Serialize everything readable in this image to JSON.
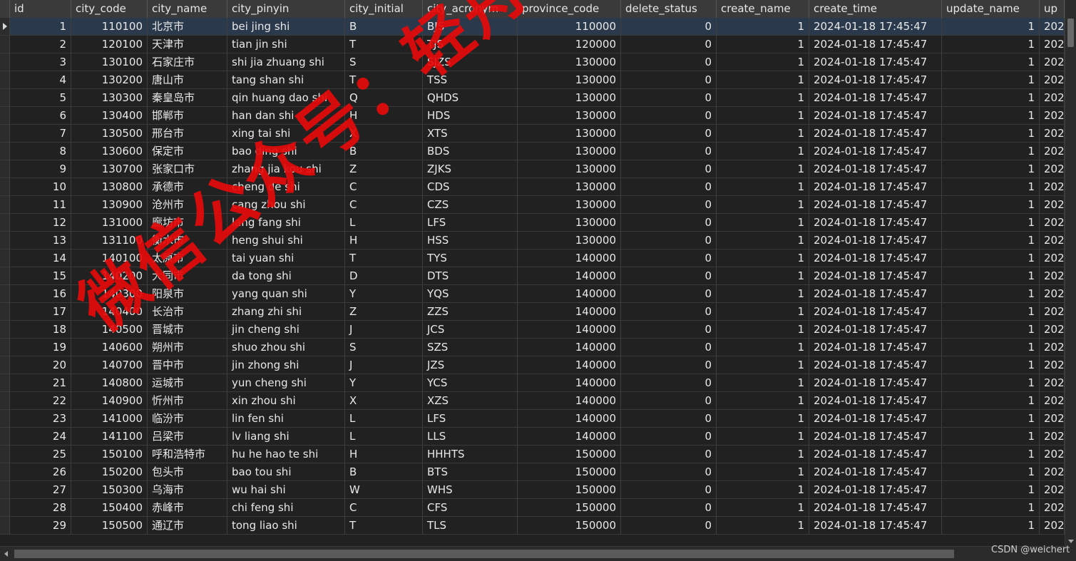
{
  "columns": [
    "id",
    "city_code",
    "city_name",
    "city_pinyin",
    "city_initial",
    "city_acronym",
    "province_code",
    "delete_status",
    "create_name",
    "create_time",
    "update_name",
    "up"
  ],
  "rows": [
    [
      "1",
      "110100",
      "北京市",
      "bei jing shi",
      "B",
      "BJS",
      "110000",
      "0",
      "1",
      "2024-01-18 17:45:47",
      "1",
      "202"
    ],
    [
      "2",
      "120100",
      "天津市",
      "tian jin shi",
      "T",
      "TJS",
      "120000",
      "0",
      "1",
      "2024-01-18 17:45:47",
      "1",
      "202"
    ],
    [
      "3",
      "130100",
      "石家庄市",
      "shi jia zhuang shi",
      "S",
      "SJZS",
      "130000",
      "0",
      "1",
      "2024-01-18 17:45:47",
      "1",
      "202"
    ],
    [
      "4",
      "130200",
      "唐山市",
      "tang shan shi",
      "T",
      "TSS",
      "130000",
      "0",
      "1",
      "2024-01-18 17:45:47",
      "1",
      "202"
    ],
    [
      "5",
      "130300",
      "秦皇岛市",
      "qin huang dao shi",
      "Q",
      "QHDS",
      "130000",
      "0",
      "1",
      "2024-01-18 17:45:47",
      "1",
      "202"
    ],
    [
      "6",
      "130400",
      "邯郸市",
      "han dan shi",
      "H",
      "HDS",
      "130000",
      "0",
      "1",
      "2024-01-18 17:45:47",
      "1",
      "202"
    ],
    [
      "7",
      "130500",
      "邢台市",
      "xing tai shi",
      "X",
      "XTS",
      "130000",
      "0",
      "1",
      "2024-01-18 17:45:47",
      "1",
      "202"
    ],
    [
      "8",
      "130600",
      "保定市",
      "bao ding shi",
      "B",
      "BDS",
      "130000",
      "0",
      "1",
      "2024-01-18 17:45:47",
      "1",
      "202"
    ],
    [
      "9",
      "130700",
      "张家口市",
      "zhang jia kou shi",
      "Z",
      "ZJKS",
      "130000",
      "0",
      "1",
      "2024-01-18 17:45:47",
      "1",
      "202"
    ],
    [
      "10",
      "130800",
      "承德市",
      "cheng de shi",
      "C",
      "CDS",
      "130000",
      "0",
      "1",
      "2024-01-18 17:45:47",
      "1",
      "202"
    ],
    [
      "11",
      "130900",
      "沧州市",
      "cang zhou shi",
      "C",
      "CZS",
      "130000",
      "0",
      "1",
      "2024-01-18 17:45:47",
      "1",
      "202"
    ],
    [
      "12",
      "131000",
      "廊坊市",
      "lang fang shi",
      "L",
      "LFS",
      "130000",
      "0",
      "1",
      "2024-01-18 17:45:47",
      "1",
      "202"
    ],
    [
      "13",
      "131100",
      "衡水市",
      "heng shui shi",
      "H",
      "HSS",
      "130000",
      "0",
      "1",
      "2024-01-18 17:45:47",
      "1",
      "202"
    ],
    [
      "14",
      "140100",
      "太原市",
      "tai yuan shi",
      "T",
      "TYS",
      "140000",
      "0",
      "1",
      "2024-01-18 17:45:47",
      "1",
      "202"
    ],
    [
      "15",
      "140200",
      "大同市",
      "da tong shi",
      "D",
      "DTS",
      "140000",
      "0",
      "1",
      "2024-01-18 17:45:47",
      "1",
      "202"
    ],
    [
      "16",
      "140300",
      "阳泉市",
      "yang quan shi",
      "Y",
      "YQS",
      "140000",
      "0",
      "1",
      "2024-01-18 17:45:47",
      "1",
      "202"
    ],
    [
      "17",
      "140400",
      "长治市",
      "zhang zhi shi",
      "Z",
      "ZZS",
      "140000",
      "0",
      "1",
      "2024-01-18 17:45:47",
      "1",
      "202"
    ],
    [
      "18",
      "140500",
      "晋城市",
      "jin cheng shi",
      "J",
      "JCS",
      "140000",
      "0",
      "1",
      "2024-01-18 17:45:47",
      "1",
      "202"
    ],
    [
      "19",
      "140600",
      "朔州市",
      "shuo zhou shi",
      "S",
      "SZS",
      "140000",
      "0",
      "1",
      "2024-01-18 17:45:47",
      "1",
      "202"
    ],
    [
      "20",
      "140700",
      "晋中市",
      "jin zhong shi",
      "J",
      "JZS",
      "140000",
      "0",
      "1",
      "2024-01-18 17:45:47",
      "1",
      "202"
    ],
    [
      "21",
      "140800",
      "运城市",
      "yun cheng shi",
      "Y",
      "YCS",
      "140000",
      "0",
      "1",
      "2024-01-18 17:45:47",
      "1",
      "202"
    ],
    [
      "22",
      "140900",
      "忻州市",
      "xin zhou shi",
      "X",
      "XZS",
      "140000",
      "0",
      "1",
      "2024-01-18 17:45:47",
      "1",
      "202"
    ],
    [
      "23",
      "141000",
      "临汾市",
      "lin fen shi",
      "L",
      "LFS",
      "140000",
      "0",
      "1",
      "2024-01-18 17:45:47",
      "1",
      "202"
    ],
    [
      "24",
      "141100",
      "吕梁市",
      "lv liang shi",
      "L",
      "LLS",
      "140000",
      "0",
      "1",
      "2024-01-18 17:45:47",
      "1",
      "202"
    ],
    [
      "25",
      "150100",
      "呼和浩特市",
      "hu he hao te shi",
      "H",
      "HHHTS",
      "150000",
      "0",
      "1",
      "2024-01-18 17:45:47",
      "1",
      "202"
    ],
    [
      "26",
      "150200",
      "包头市",
      "bao tou shi",
      "B",
      "BTS",
      "150000",
      "0",
      "1",
      "2024-01-18 17:45:47",
      "1",
      "202"
    ],
    [
      "27",
      "150300",
      "乌海市",
      "wu hai shi",
      "W",
      "WHS",
      "150000",
      "0",
      "1",
      "2024-01-18 17:45:47",
      "1",
      "202"
    ],
    [
      "28",
      "150400",
      "赤峰市",
      "chi feng shi",
      "C",
      "CFS",
      "150000",
      "0",
      "1",
      "2024-01-18 17:45:47",
      "1",
      "202"
    ],
    [
      "29",
      "150500",
      "通辽市",
      "tong liao shi",
      "T",
      "TLS",
      "150000",
      "0",
      "1",
      "2024-01-18 17:45:47",
      "1",
      "202"
    ]
  ],
  "selected_row": 0,
  "watermark_overlay": "微信公众号：轻舟编程",
  "watermark_corner": "CSDN @weichert",
  "colors": {
    "background": "#212121",
    "header": "#3a3a3a",
    "text": "#e8e8e8",
    "stamp": "#e60a0a",
    "selected": "#2a3a4c"
  }
}
